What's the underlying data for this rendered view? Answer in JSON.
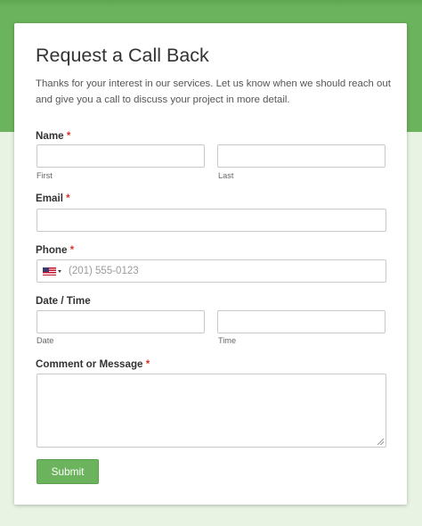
{
  "form": {
    "title": "Request a Call Back",
    "intro": "Thanks for your interest in our services. Let us know when we should reach out and give you a call to discuss your project in more detail.",
    "name": {
      "label": "Name",
      "required": "*",
      "first_sub": "First",
      "last_sub": "Last",
      "first_value": "",
      "last_value": ""
    },
    "email": {
      "label": "Email",
      "required": "*",
      "value": ""
    },
    "phone": {
      "label": "Phone",
      "required": "*",
      "placeholder": "(201) 555-0123",
      "country_icon": "us-flag-icon"
    },
    "datetime": {
      "label": "Date / Time",
      "date_sub": "Date",
      "time_sub": "Time",
      "date_value": "",
      "time_value": ""
    },
    "comment": {
      "label": "Comment or Message",
      "required": "*",
      "value": ""
    },
    "submit_label": "Submit"
  },
  "colors": {
    "accent": "#6bb35c",
    "background": "#e8f3e4",
    "required": "#d8342e"
  }
}
